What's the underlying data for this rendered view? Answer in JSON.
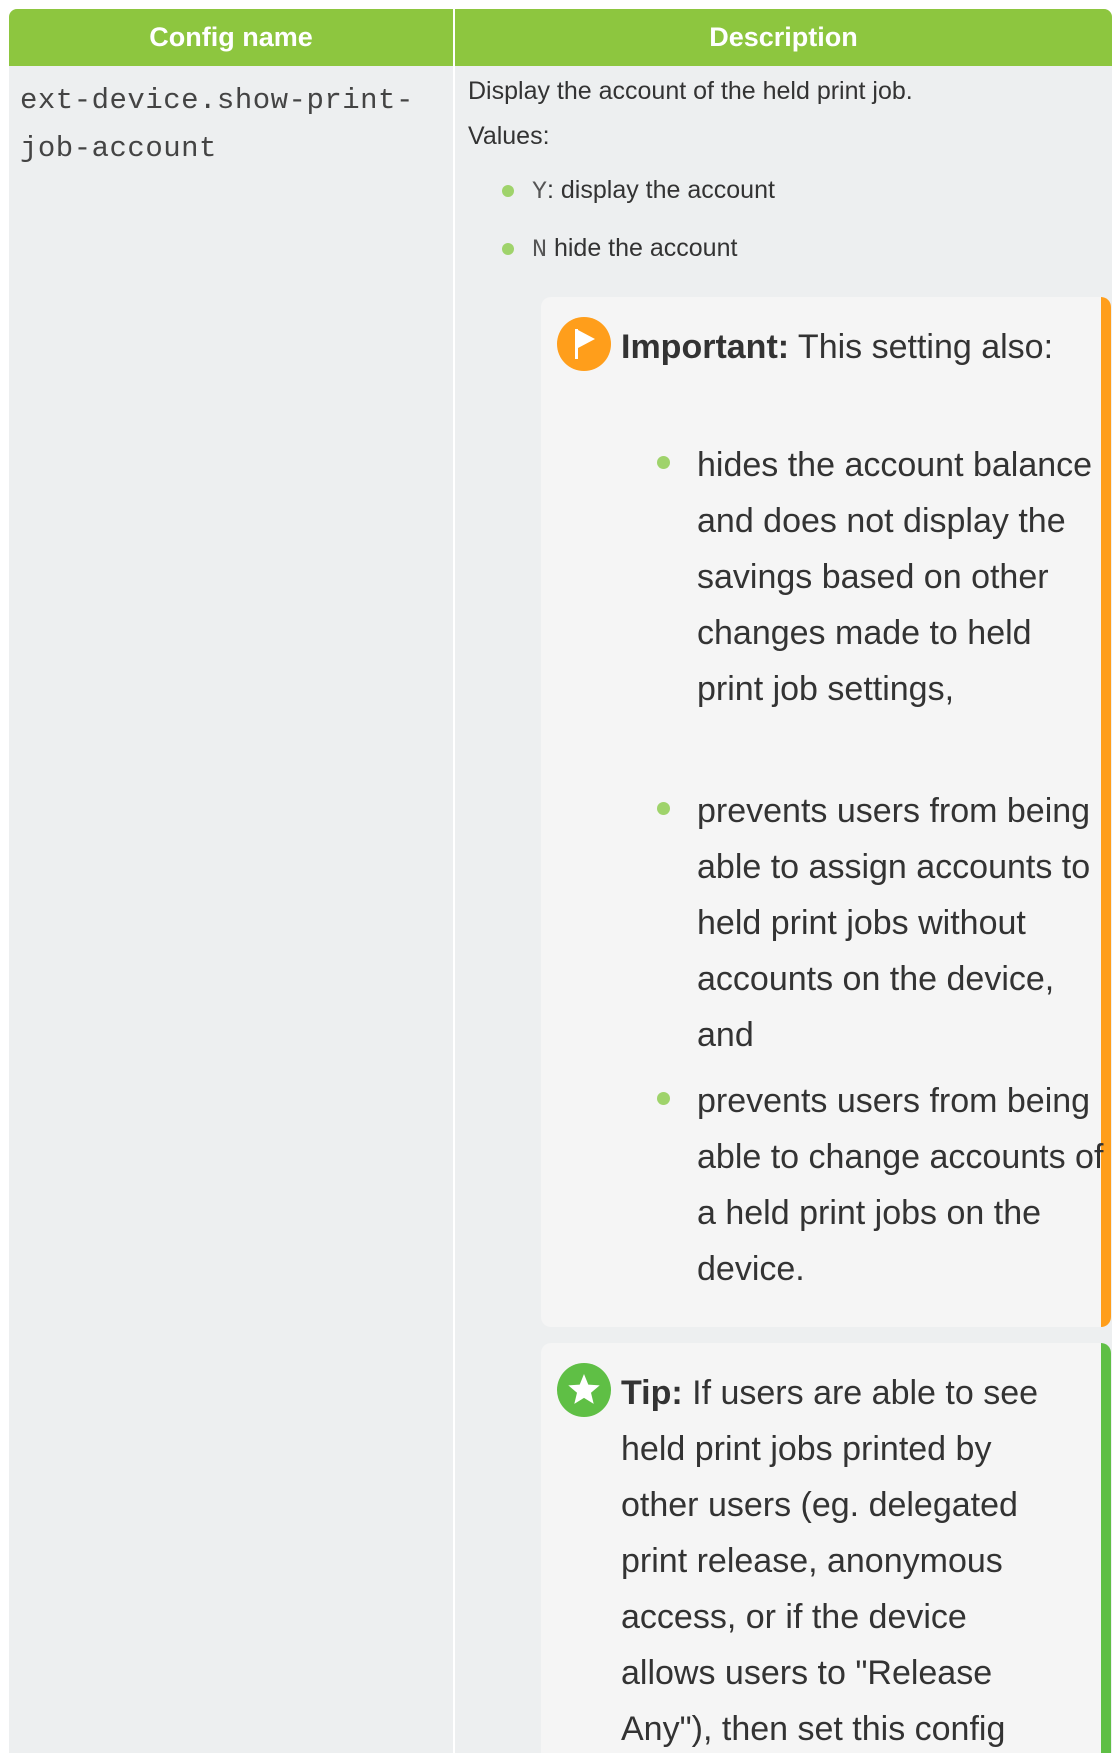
{
  "table": {
    "headers": {
      "config_name": "Config name",
      "description": "Description"
    },
    "row": {
      "config_name": "ext-device.show-print-job-account",
      "description": "Display the account of the held print job.",
      "values_label": "Values:",
      "values": [
        {
          "code": "Y",
          "text": ": display the account"
        },
        {
          "code": "N",
          "text": " hide the account"
        }
      ],
      "important": {
        "label": "Important:",
        "text": " This setting also:",
        "items": [
          "hides the account balance and does not display the savings based on other changes made to held print job settings,",
          "prevents users from being able to assign accounts to held print jobs without accounts on the device, and",
          "prevents users from being able to change accounts of a held print jobs on the device."
        ]
      },
      "tip": {
        "label": "Tip:",
        "text": " If users are able to see held print jobs printed by other users (eg. delegated print release, anonymous access, or if the device allows users to \"Release Any\"), then set this config"
      }
    }
  },
  "colors": {
    "header_green": "#8dc63f",
    "important_orange": "#ff9e1b",
    "tip_green": "#5fbf45",
    "bullet_green": "#9fd36b"
  },
  "icons": {
    "important": "flag-icon",
    "tip": "star-icon"
  }
}
